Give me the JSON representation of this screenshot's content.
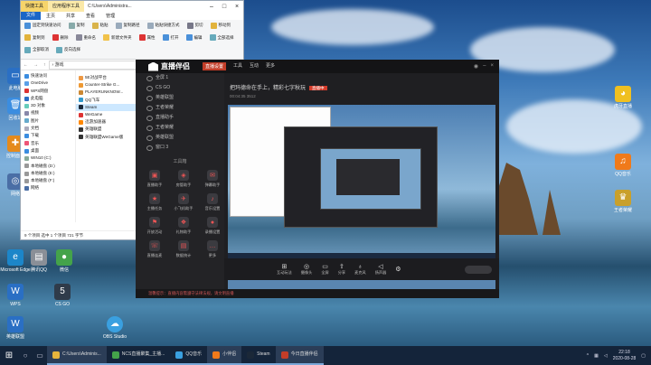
{
  "explorer": {
    "title_context_tab": "快捷工具",
    "title_context_tab2": "应用程序工具",
    "path_title": "C:\\Users\\Administra...",
    "tabs": [
      "文件",
      "主页",
      "共享",
      "查看",
      "管理"
    ],
    "ribbon": [
      "固定到快速访问",
      "复制",
      "粘贴",
      "复制路径",
      "粘贴快捷方式",
      "剪切",
      "移动到",
      "复制到",
      "删除",
      "重命名",
      "新建文件夹",
      "属性",
      "打开",
      "编辑",
      "全部选择",
      "全部取消",
      "反向选择"
    ],
    "address": "› 游戏",
    "nav": [
      "快速访问",
      "OneDrive",
      "WPS网盘",
      "此电脑",
      "3D 对象",
      "视频",
      "图片",
      "文档",
      "下载",
      "音乐",
      "桌面",
      "WIN10 (C:)",
      "本地磁盘 (D:)",
      "本地磁盘 (E:)",
      "本地磁盘 (F:)",
      "网络"
    ],
    "files": [
      {
        "name": "5E对战平台",
        "date": "201"
      },
      {
        "name": "Counter-Strike G...",
        "date": "201"
      },
      {
        "name": "PLAYERUNKNOW...",
        "date": "201"
      },
      {
        "name": "QQ飞车",
        "date": "201"
      },
      {
        "name": "Steam",
        "date": "201"
      },
      {
        "name": "WeGame",
        "date": "201"
      },
      {
        "name": "迅游加速器",
        "date": "201"
      },
      {
        "name": "英雄联盟",
        "date": "201"
      },
      {
        "name": "英雄联盟WeGame版",
        "date": "201"
      }
    ],
    "status": "9 个项目    选中 1 个项目  721 字节"
  },
  "app": {
    "brand": "直播伴侣",
    "topnav": [
      "直播设置",
      "工具",
      "互动",
      "更多"
    ],
    "title_info": "把玛德命在手上，精彩七字秋玩",
    "badge": "直播中",
    "sub_info": "00:04:35  3512",
    "scenes": [
      "全屏 1",
      "CS GO",
      "英雄联盟",
      "王者荣耀",
      "直播助手",
      "王者荣耀",
      "英雄联盟",
      "窗口 3"
    ],
    "tools_header": "工具箱",
    "tools": [
      "直播助手",
      "房管助手",
      "弹幕助手",
      "主播任务",
      "小飞机助手",
      "音乐设置",
      "开放活动",
      "礼物助手",
      "录播设置",
      "直播连麦",
      "数据统计",
      "更多"
    ],
    "bottom": [
      "互动玩法",
      "摄像头",
      "全屏",
      "分享",
      "麦克风",
      "扬声器"
    ],
    "footer": "温馨提示：直播内容需遵守法律法规，请文明直播"
  },
  "desktop_icons": [
    "此电脑",
    "回收站",
    "控制面板",
    "网络",
    "Microsoft Edge",
    "腾讯QQ",
    "微信",
    "WPS",
    "CS GO",
    "英雄联盟",
    "OBS Studio",
    "虎牙直播",
    "QQ音乐",
    "王者荣耀"
  ],
  "taskbar": {
    "tasks": [
      "C:\\Users\\Adminis...",
      "NCS直播聚集_主播...",
      "QQ音乐",
      "小伴侣",
      "Steam",
      "今日直播伴侣"
    ],
    "time": "22:18",
    "date": "2020-08-28"
  },
  "colors": {
    "accent": "#c23d28",
    "taskbar": "#14243a",
    "file_tab": "#1a66c7"
  }
}
